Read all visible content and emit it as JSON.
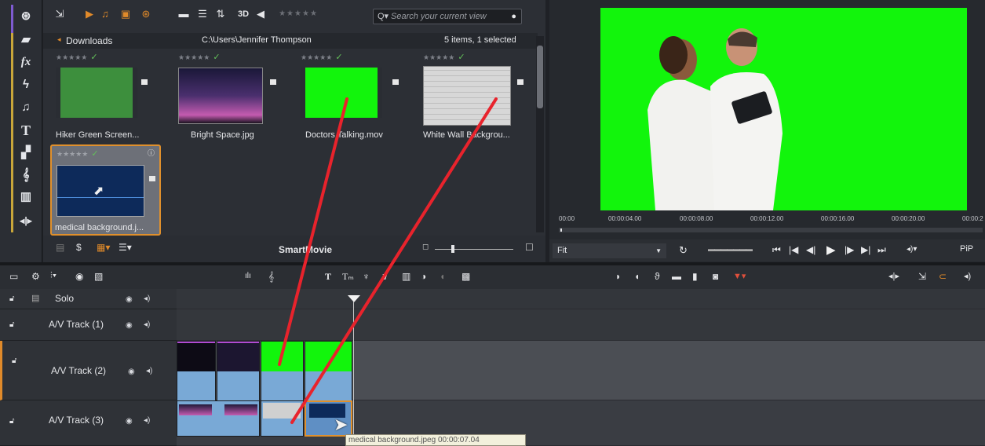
{
  "sidebar": {
    "icons": [
      "library-icon",
      "media-icon",
      "effects-icon",
      "transitions-icon",
      "music-icon",
      "title-icon",
      "montage-icon",
      "score-icon",
      "sound-effects-icon",
      "audio-icon"
    ],
    "fx_label": "fx",
    "title_label": "T"
  },
  "library": {
    "toolbar": {
      "view_3d": "3D",
      "search_placeholder": "Search your current view"
    },
    "folder": "Downloads",
    "path": "C:\\Users\\Jennifer Thompson",
    "selection_status": "5 items, 1 selected",
    "items": [
      {
        "caption": "Hiker Green Screen...",
        "rating": "★★★★★"
      },
      {
        "caption": "Bright Space.jpg",
        "rating": "★★★★★"
      },
      {
        "caption": "Doctors Talking.mov",
        "rating": "★★★★★"
      },
      {
        "caption": "White Wall Backgrou...",
        "rating": "★★★★★"
      },
      {
        "caption": "medical background.j...",
        "rating": "★★★★★"
      }
    ],
    "smart_movie_label": "SmartMovie"
  },
  "preview": {
    "ruler_ticks": [
      "00:00",
      "00:00:04.00",
      "00:00:08.00",
      "00:00:12.00",
      "00:00:16.00",
      "00:00:20.00",
      "00:00:2"
    ],
    "fit_label": "Fit",
    "pip_label": "PiP"
  },
  "timeline": {
    "tracks": [
      {
        "name": "Solo"
      },
      {
        "name": "A/V Track (1)"
      },
      {
        "name": "A/V Track (2)"
      },
      {
        "name": "A/V Track (3)"
      }
    ],
    "tooltip": "medical background.jpeg  00:00:07.04"
  },
  "colors": {
    "accent_orange": "#e08a2a",
    "green_screen": "#12f50c",
    "selection_orange": "#e0902c",
    "annotation_red": "#e8232c"
  }
}
